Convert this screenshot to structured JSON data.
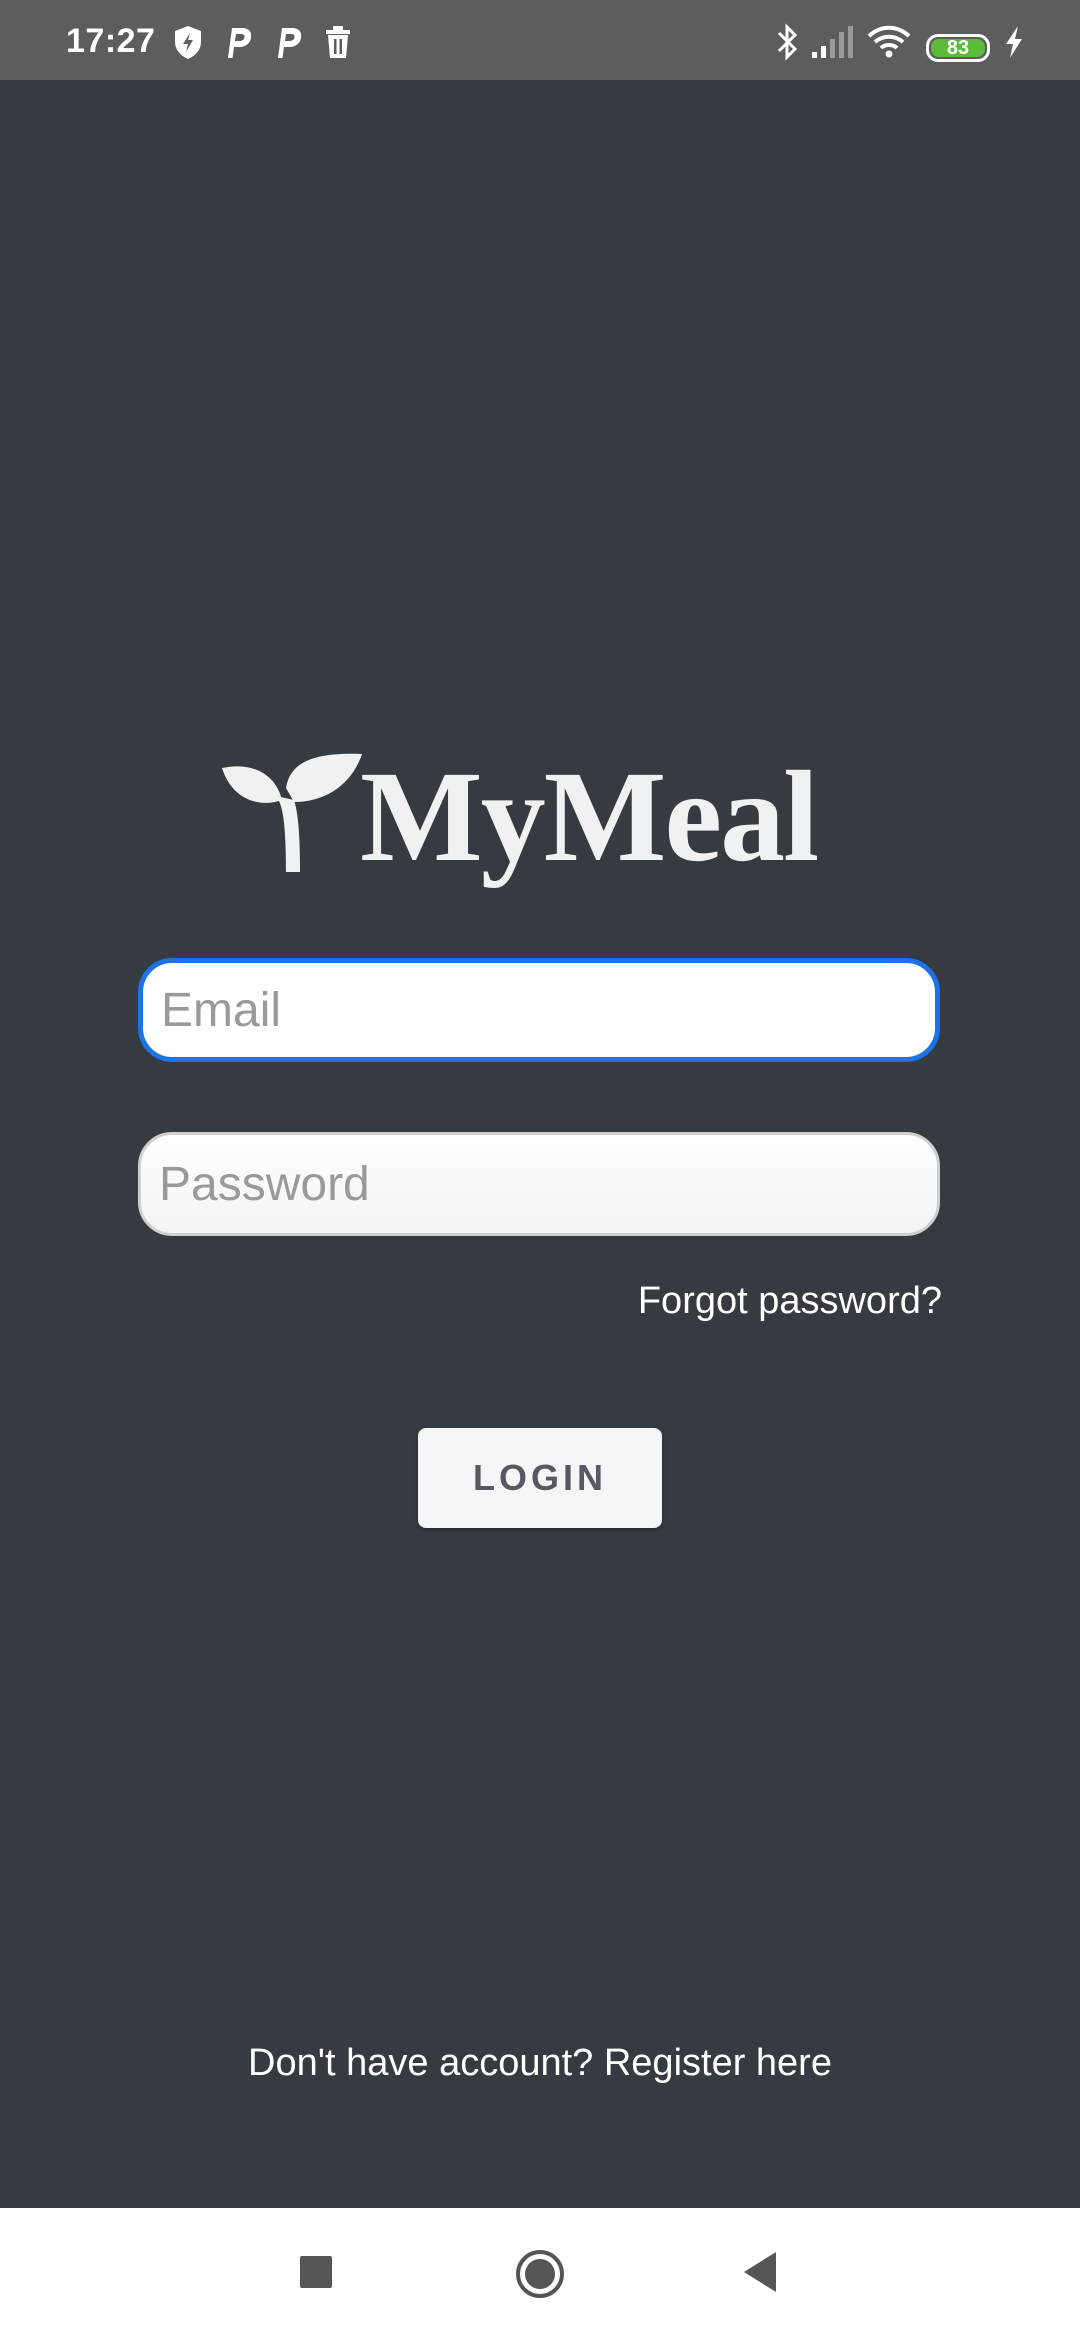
{
  "status_bar": {
    "time": "17:27",
    "notification_icons": [
      "shield-bolt-icon",
      "parking-icon",
      "parking-icon",
      "trash-icon"
    ],
    "system_icons": [
      "bluetooth-icon",
      "signal-icon",
      "wifi-icon"
    ],
    "battery_level": "83",
    "charging": true
  },
  "app": {
    "logo_text": "MyMeal"
  },
  "form": {
    "email_placeholder": "Email",
    "password_placeholder": "Password",
    "forgot_password_label": "Forgot password?",
    "login_label": "LOGIN",
    "register_label": "Don't have account? Register here"
  },
  "colors": {
    "background": "#363a41",
    "focus_border": "#1a73e8",
    "battery_fill": "#5dbb3a"
  }
}
